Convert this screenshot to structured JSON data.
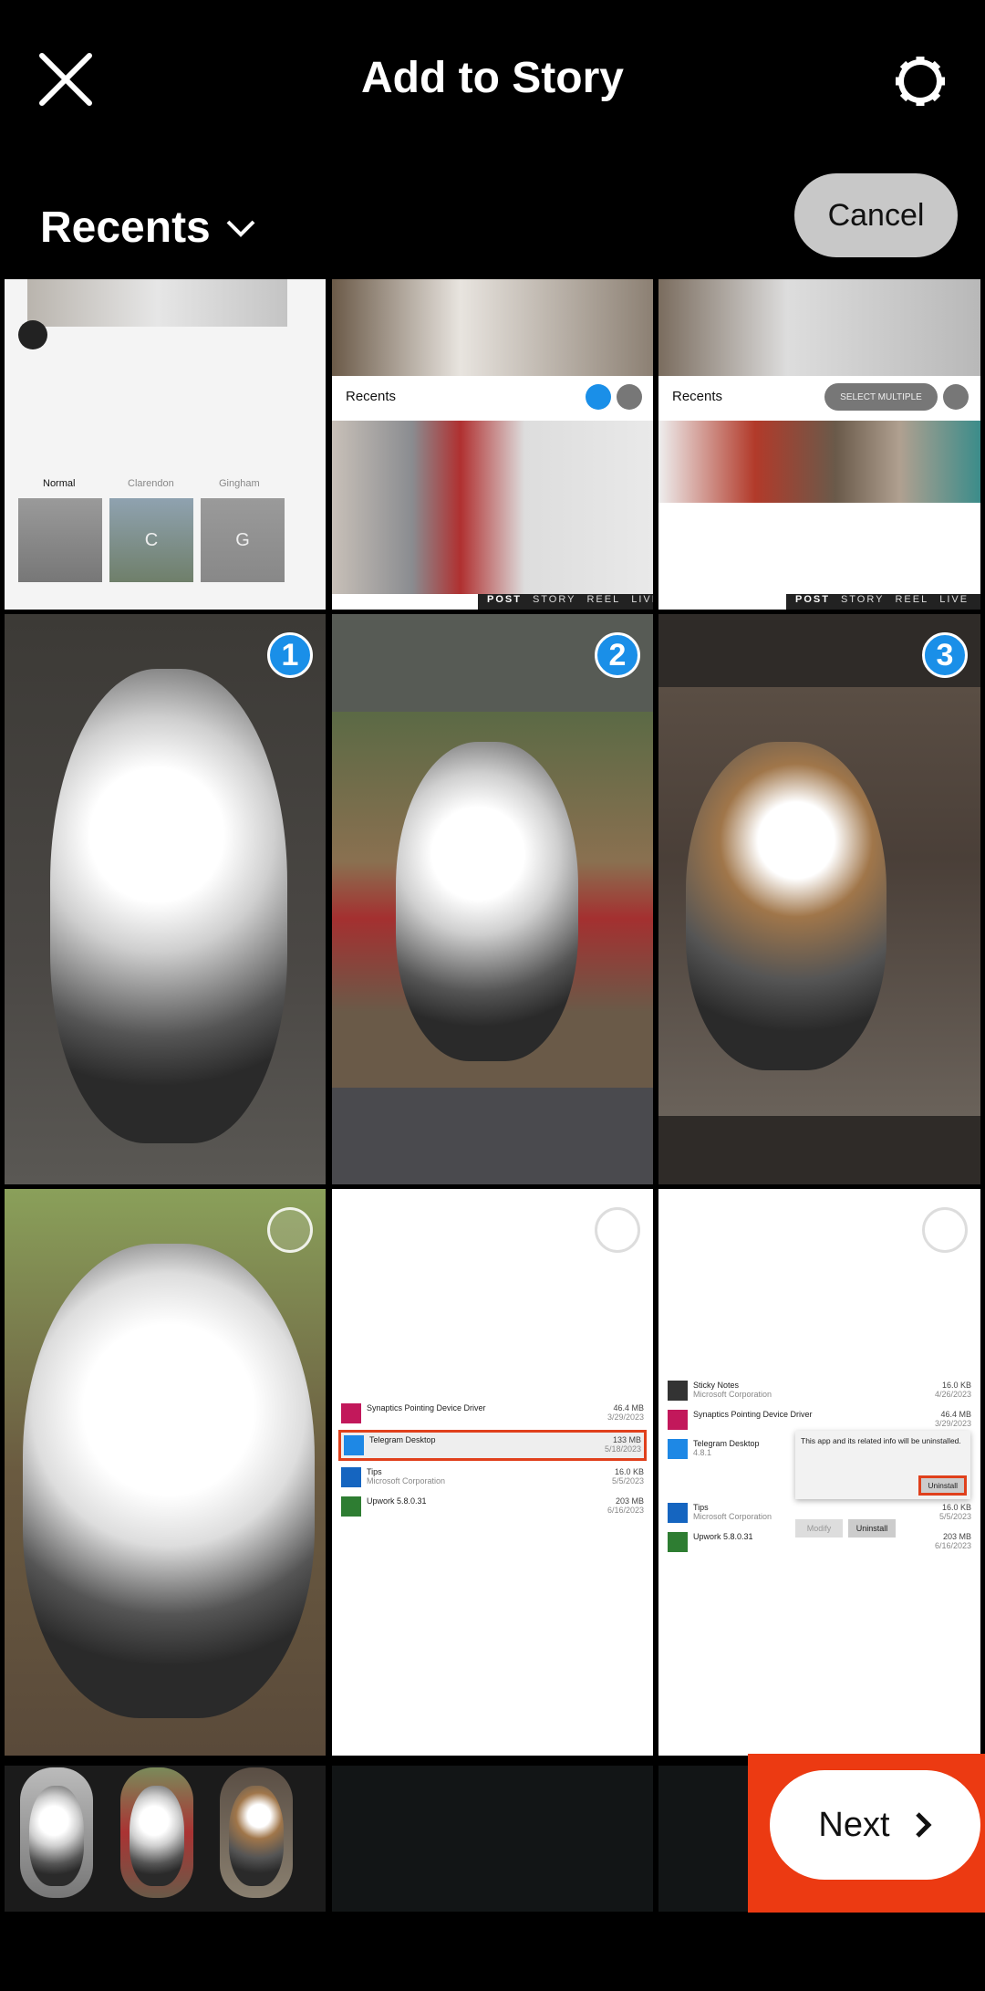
{
  "header": {
    "title": "Add to Story",
    "close_icon": "close-icon",
    "settings_icon": "gear-icon"
  },
  "toolbar": {
    "album": "Recents",
    "cancel_label": "Cancel"
  },
  "thumb_screens": {
    "filters": [
      "Normal",
      "Clarendon",
      "Gingham"
    ],
    "filter_letters": [
      "C",
      "G"
    ],
    "recents": "Recents",
    "select_multiple": "SELECT MULTIPLE",
    "modes": [
      "POST",
      "STORY",
      "REEL",
      "LIVE"
    ]
  },
  "photos": [
    {
      "badge": "1",
      "selected": true
    },
    {
      "badge": "2",
      "selected": true
    },
    {
      "badge": "3",
      "selected": true
    },
    {
      "badge": "",
      "selected": false
    },
    {
      "badge": "",
      "selected": false
    },
    {
      "badge": "",
      "selected": false
    }
  ],
  "apps_left": [
    {
      "name": "Synaptics Pointing Device Driver",
      "sub": "",
      "size": "46.4 MB",
      "date": "3/29/2023",
      "color": "#c2185b"
    },
    {
      "name": "Telegram Desktop",
      "sub": "",
      "size": "133 MB",
      "date": "5/18/2023",
      "color": "#1e88e5"
    },
    {
      "name": "Tips",
      "sub": "Microsoft Corporation",
      "size": "16.0 KB",
      "date": "5/5/2023",
      "color": "#1565c0"
    },
    {
      "name": "Upwork 5.8.0.31",
      "sub": "",
      "size": "203 MB",
      "date": "6/16/2023",
      "color": "#2e7d32"
    }
  ],
  "apps_right": [
    {
      "name": "Sticky Notes",
      "sub": "Microsoft Corporation",
      "size": "16.0 KB",
      "date": "4/26/2023",
      "color": "#333"
    },
    {
      "name": "Synaptics Pointing Device Driver",
      "sub": "",
      "size": "46.4 MB",
      "date": "3/29/2023",
      "color": "#c2185b"
    },
    {
      "name": "Telegram Desktop",
      "sub": "4.8.1",
      "size": "",
      "date": "",
      "color": "#1e88e5"
    },
    {
      "name": "Tips",
      "sub": "Microsoft Corporation",
      "size": "16.0 KB",
      "date": "5/5/2023",
      "color": "#1565c0"
    },
    {
      "name": "Upwork 5.8.0.31",
      "sub": "",
      "size": "203 MB",
      "date": "6/16/2023",
      "color": "#2e7d32"
    }
  ],
  "uninstall_popup": {
    "message": "This app and its related info will be uninstalled.",
    "confirm": "Uninstall",
    "modify": "Modify",
    "uninstall": "Uninstall"
  },
  "footer": {
    "next_label": "Next",
    "highlight_color": "#ec3a12",
    "selected_count": 3
  }
}
